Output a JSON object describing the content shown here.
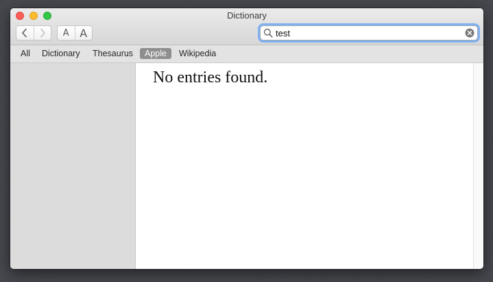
{
  "window": {
    "title": "Dictionary",
    "traffic_colors": {
      "close": "#fc5f57",
      "minimize": "#fdbc2e",
      "zoom": "#33c748"
    }
  },
  "toolbar": {
    "back_icon": "chevron-left-icon",
    "forward_icon": "chevron-right-icon",
    "font_smaller_label": "A",
    "font_larger_label": "A"
  },
  "search": {
    "value": "test",
    "placeholder": "",
    "search_icon": "magnifier-icon",
    "clear_icon": "clear-x-circle-icon",
    "focus_ring_color": "#7fb0f1"
  },
  "tabs": [
    {
      "label": "All",
      "selected": false
    },
    {
      "label": "Dictionary",
      "selected": false
    },
    {
      "label": "Thesaurus",
      "selected": false
    },
    {
      "label": "Apple",
      "selected": true
    },
    {
      "label": "Wikipedia",
      "selected": false
    }
  ],
  "content": {
    "message": "No entries found."
  }
}
